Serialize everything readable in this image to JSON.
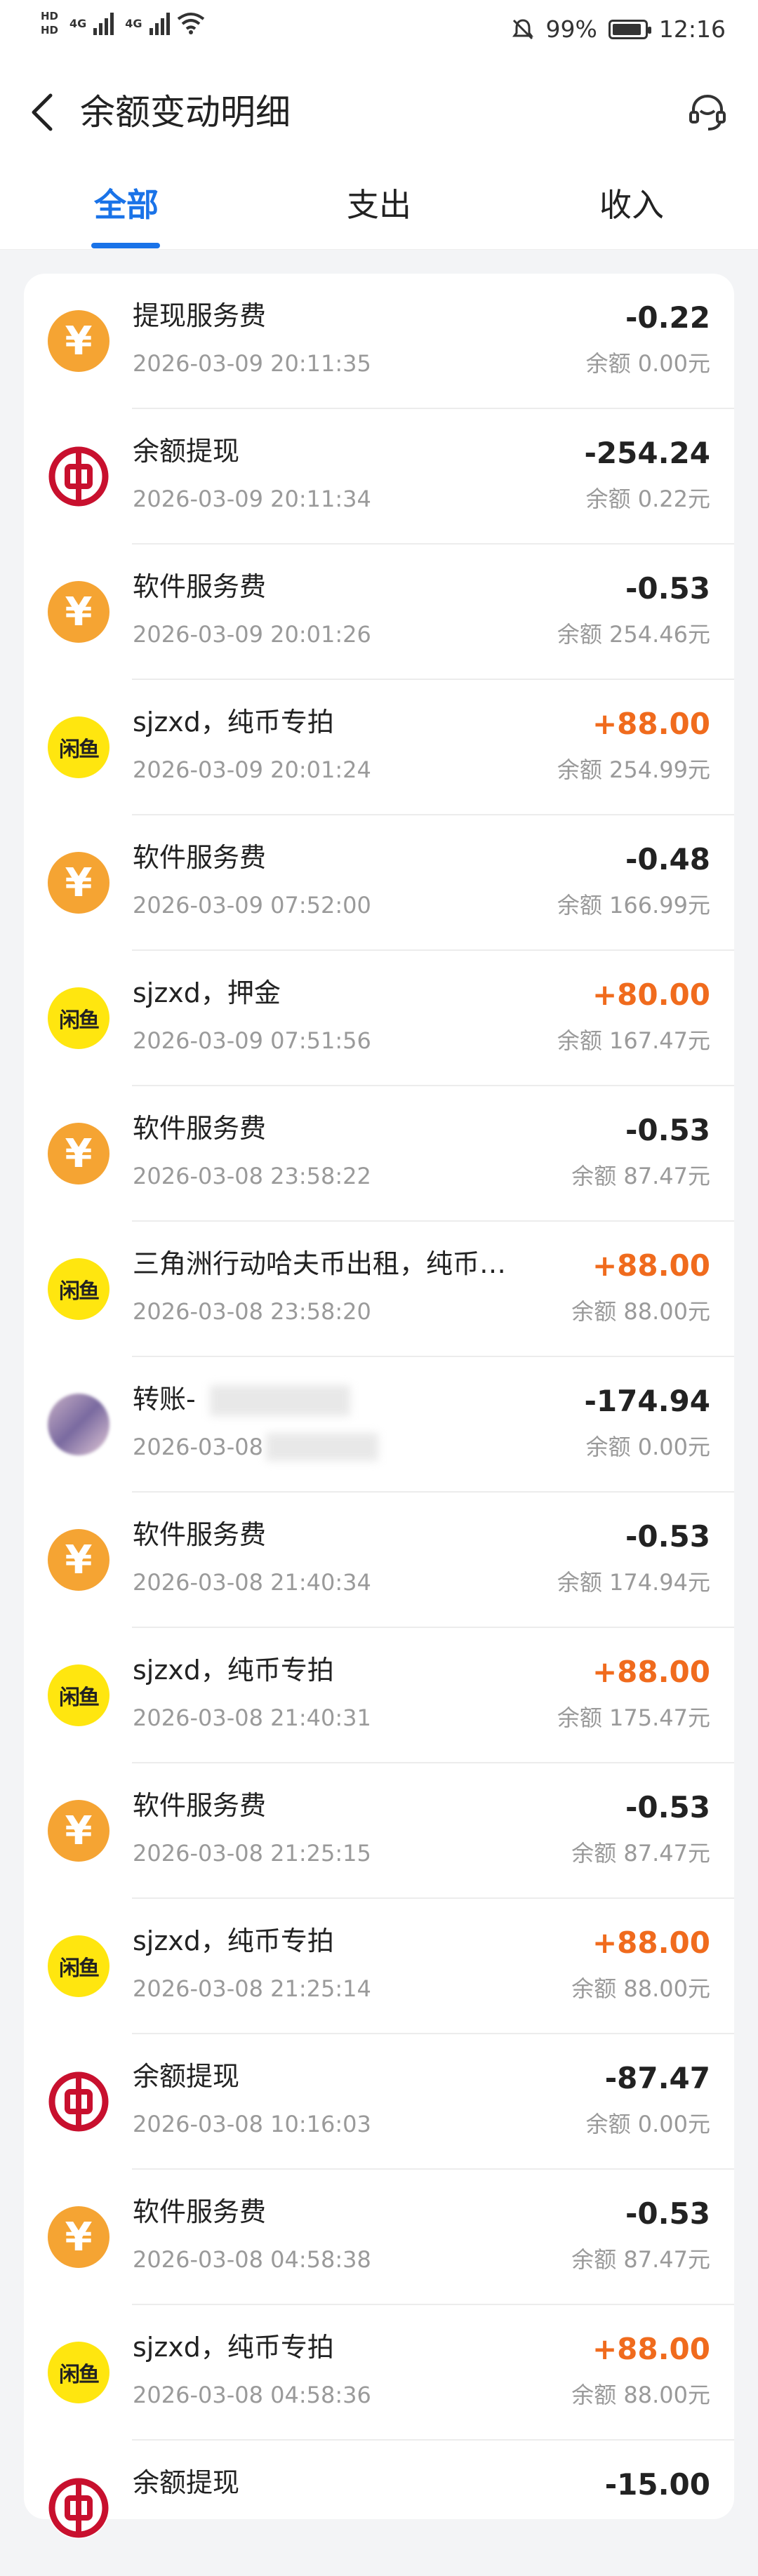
{
  "status_bar": {
    "hd1": "HD",
    "hd2": "HD",
    "net1": "4G",
    "net2": "4G",
    "battery_percent": "99%",
    "time": "12:16"
  },
  "header": {
    "title": "余额变动明细",
    "back_icon": "chevron-left-icon",
    "service_icon": "headset-icon"
  },
  "tabs": [
    {
      "label": "全部",
      "active": true
    },
    {
      "label": "支出",
      "active": false
    },
    {
      "label": "收入",
      "active": false
    }
  ],
  "transactions": [
    {
      "icon": "yuan",
      "title": "提现服务费",
      "time": "2026-03-09 20:11:35",
      "amount": "-0.22",
      "balance": "余额 0.00元"
    },
    {
      "icon": "boc",
      "title": "余额提现",
      "time": "2026-03-09 20:11:34",
      "amount": "-254.24",
      "balance": "余额 0.22元"
    },
    {
      "icon": "yuan",
      "title": "软件服务费",
      "time": "2026-03-09 20:01:26",
      "amount": "-0.53",
      "balance": "余额 254.46元"
    },
    {
      "icon": "xianyu",
      "title": "sjzxd，纯币专拍",
      "time": "2026-03-09 20:01:24",
      "amount": "+88.00",
      "balance": "余额 254.99元"
    },
    {
      "icon": "yuan",
      "title": "软件服务费",
      "time": "2026-03-09 07:52:00",
      "amount": "-0.48",
      "balance": "余额 166.99元"
    },
    {
      "icon": "xianyu",
      "title": "sjzxd，押金",
      "time": "2026-03-09 07:51:56",
      "amount": "+80.00",
      "balance": "余额 167.47元"
    },
    {
      "icon": "yuan",
      "title": "软件服务费",
      "time": "2026-03-08 23:58:22",
      "amount": "-0.53",
      "balance": "余额 87.47元"
    },
    {
      "icon": "xianyu",
      "title": "三角洲行动哈夫币出租，纯币哈夫...",
      "time": "2026-03-08 23:58:20",
      "amount": "+88.00",
      "balance": "余额 88.00元"
    },
    {
      "icon": "avatar",
      "title": "转账-",
      "time": "2026-03-08",
      "amount": "-174.94",
      "balance": "余额 0.00元"
    },
    {
      "icon": "yuan",
      "title": "软件服务费",
      "time": "2026-03-08 21:40:34",
      "amount": "-0.53",
      "balance": "余额 174.94元"
    },
    {
      "icon": "xianyu",
      "title": "sjzxd，纯币专拍",
      "time": "2026-03-08 21:40:31",
      "amount": "+88.00",
      "balance": "余额 175.47元"
    },
    {
      "icon": "yuan",
      "title": "软件服务费",
      "time": "2026-03-08 21:25:15",
      "amount": "-0.53",
      "balance": "余额 87.47元"
    },
    {
      "icon": "xianyu",
      "title": "sjzxd，纯币专拍",
      "time": "2026-03-08 21:25:14",
      "amount": "+88.00",
      "balance": "余额 88.00元"
    },
    {
      "icon": "boc",
      "title": "余额提现",
      "time": "2026-03-08 10:16:03",
      "amount": "-87.47",
      "balance": "余额 0.00元"
    },
    {
      "icon": "yuan",
      "title": "软件服务费",
      "time": "2026-03-08 04:58:38",
      "amount": "-0.53",
      "balance": "余额 87.47元"
    },
    {
      "icon": "xianyu",
      "title": "sjzxd，纯币专拍",
      "time": "2026-03-08 04:58:36",
      "amount": "+88.00",
      "balance": "余额 88.00元"
    },
    {
      "icon": "boc",
      "title": "余额提现",
      "time": "",
      "amount": "-15.00",
      "balance": ""
    }
  ],
  "icon_text": {
    "yuan": "¥",
    "xianyu": "闲鱼"
  },
  "colors": {
    "accent": "#1a73e8",
    "income": "#f06b1d",
    "yuan_icon": "#f5a433",
    "xianyu_icon": "#ffe60f",
    "boc_icon": "#c8102e"
  }
}
